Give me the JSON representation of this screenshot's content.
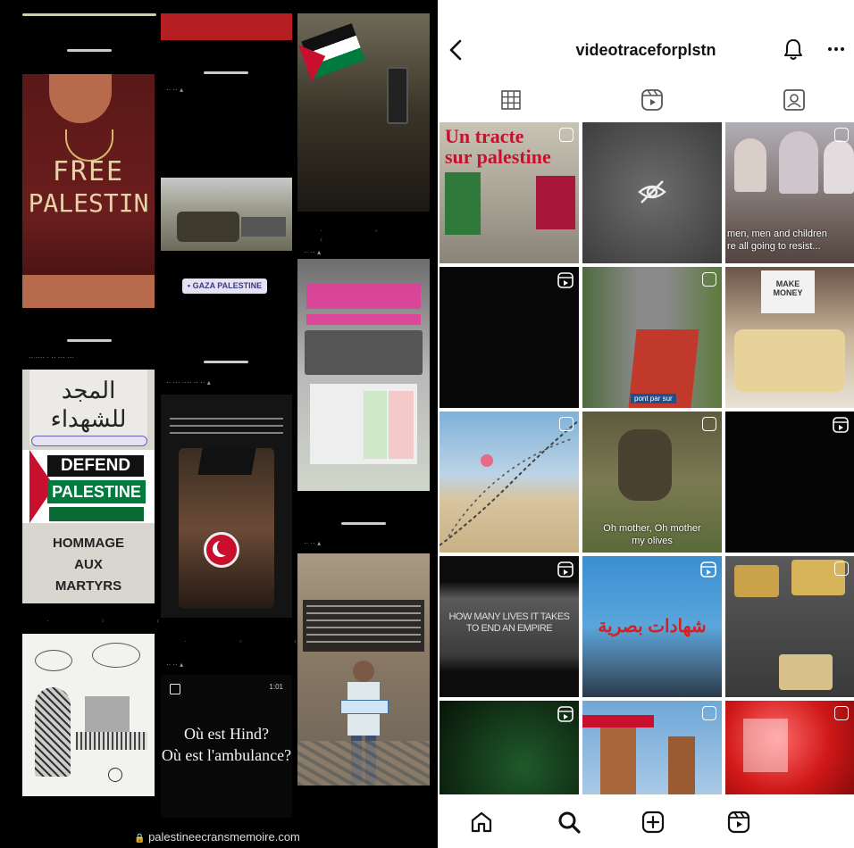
{
  "left_collage": {
    "tshirt": {
      "line1": "FREE",
      "line2": "PALESTIN"
    },
    "gaza_tag": "• GAZA PALESTINE",
    "poster": {
      "arabic1": "المجد",
      "arabic2": "للشهداء",
      "defend": "DEFEND",
      "palestine": "PALESTINE",
      "hommage1": "HOMMAGE",
      "hommage2": "AUX",
      "hommage3": "MARTYRS"
    },
    "hind_story": {
      "line1": "Où est Hind?",
      "line2": "Où est l'ambulance?"
    },
    "footer_url": "palestineecransmemoire.com"
  },
  "profile": {
    "username": "videotraceforplstn",
    "tabs": [
      {
        "icon": "grid-icon"
      },
      {
        "icon": "reels-icon"
      },
      {
        "icon": "tagged-icon"
      }
    ],
    "grid": [
      {
        "caption": "Un tracte\nsur palestine"
      },
      {
        "caption": ""
      },
      {
        "caption": "men, men and children\nre all going to resist..."
      },
      {
        "caption": ""
      },
      {
        "caption": "pont par sur"
      },
      {
        "caption": "MAKE\nMONEY"
      },
      {
        "caption": ""
      },
      {
        "caption": "Oh mother, Oh mother\nmy olives"
      },
      {
        "caption": ""
      },
      {
        "caption": "HOW MANY LIVES IT TAKES\nTO END AN EMPIRE"
      },
      {
        "caption": "شهادات بصرية"
      },
      {
        "caption": ""
      },
      {
        "caption": ""
      },
      {
        "caption": ""
      },
      {
        "caption": ""
      }
    ],
    "bottom_nav": [
      {
        "icon": "home-icon"
      },
      {
        "icon": "search-icon"
      },
      {
        "icon": "create-icon"
      },
      {
        "icon": "reels-icon"
      }
    ]
  },
  "colors": {
    "accent_red": "#c8102e",
    "green": "#007a3d"
  }
}
